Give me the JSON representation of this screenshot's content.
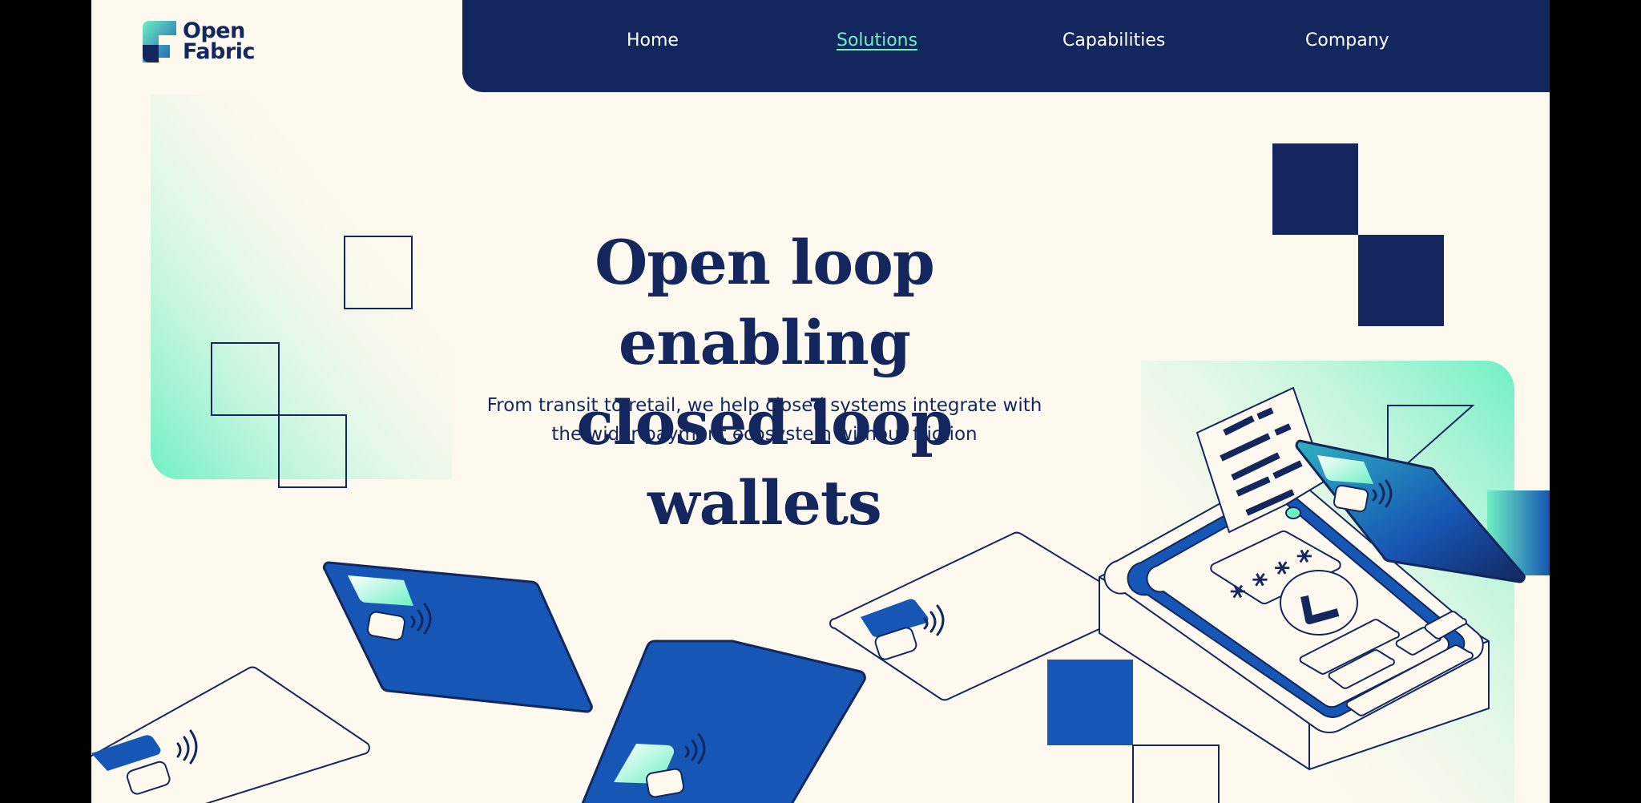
{
  "brand": {
    "line1": "Open",
    "line2": "Fabric"
  },
  "nav": {
    "items": [
      {
        "label": "Home"
      },
      {
        "label": "Solutions"
      },
      {
        "label": "Capabilities"
      },
      {
        "label": "Company"
      }
    ],
    "active": "Solutions"
  },
  "hero": {
    "title_line1": "Open loop enabling",
    "title_line2": "closed loop wallets",
    "subtitle_line1": "From transit to retail, we help closed systems integrate with",
    "subtitle_line2": "the wider payment ecosystem without friction"
  },
  "illustration": {
    "pin_mask": "* * * *"
  },
  "colors": {
    "navy": "#13275e",
    "blue": "#1656b4",
    "mint": "#6ef0c3",
    "cream": "#fdf9ee"
  }
}
